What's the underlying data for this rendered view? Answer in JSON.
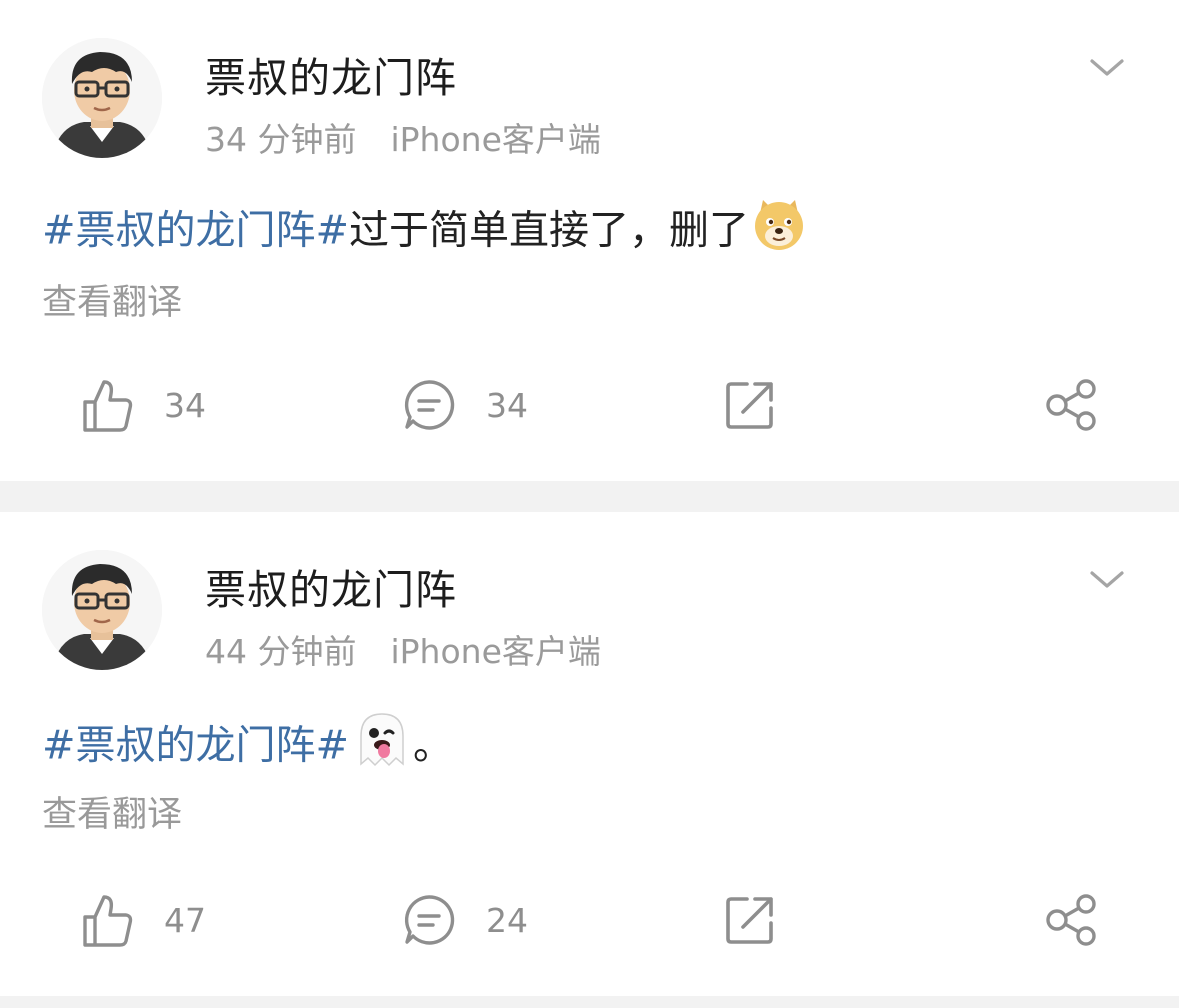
{
  "posts": [
    {
      "author": "票叔的龙门阵",
      "time": "34 分钟前",
      "source": "iPhone客户端",
      "topic": "#票叔的龙门阵#",
      "text": "过于简单直接了，删了",
      "emoji_icon": "doge-face-icon",
      "translate_label": "查看翻译",
      "likes": "34",
      "comments": "34"
    },
    {
      "author": "票叔的龙门阵",
      "time": "44 分钟前",
      "source": "iPhone客户端",
      "topic": "#票叔的龙门阵#",
      "text": "。",
      "emoji_icon": "ghost-emoji-icon",
      "translate_label": "查看翻译",
      "likes": "47",
      "comments": "24"
    }
  ],
  "colors": {
    "topic_link": "#3e6ea4",
    "meta_gray": "#9a9a9a",
    "icon_gray": "#8e8e8e",
    "divider": "#f2f2f2"
  }
}
